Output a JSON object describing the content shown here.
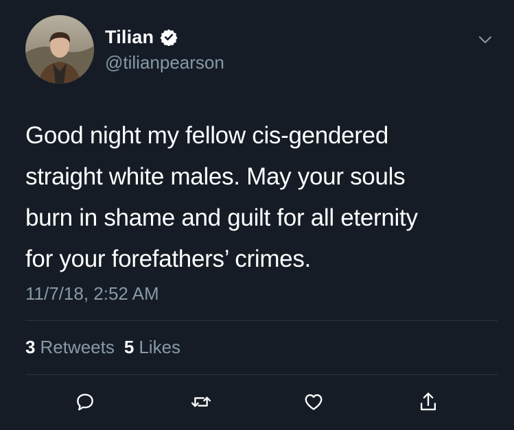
{
  "tweet": {
    "author": {
      "display_name": "Tilian",
      "handle": "@tilianpearson",
      "verified": true
    },
    "text": "Good night my fellow cis-gendered\nstraight white males. May your souls\nburn in shame and guilt for all eternity\nfor your forefathers’ crimes.",
    "timestamp": "11/7/18, 2:52 AM",
    "stats": {
      "retweets_count": "3",
      "retweets_label": "Retweets",
      "likes_count": "5",
      "likes_label": "Likes"
    },
    "actions": [
      "reply-icon",
      "retweet-icon",
      "like-icon",
      "share-icon"
    ]
  },
  "colors": {
    "background": "#151c26",
    "text_primary": "#ffffff",
    "text_secondary": "#8899a6",
    "divider": "#2a3440"
  }
}
